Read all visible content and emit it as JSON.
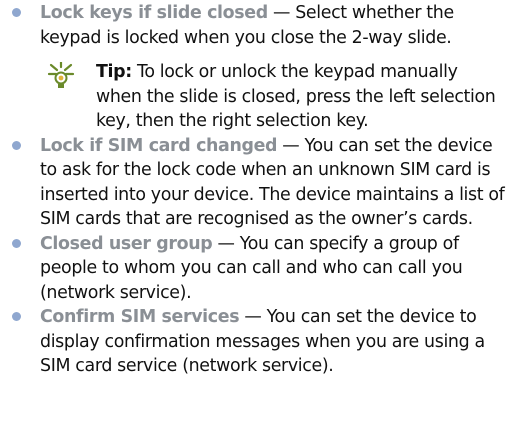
{
  "accent_colors": {
    "bullet": "#8fa7cf",
    "term": "#8a8f95",
    "tip_icon": "#6a8a2a"
  },
  "items": [
    {
      "term": "Lock keys if slide closed",
      "description": " — Select whether the keypad is locked when you close the 2-way slide."
    },
    {
      "term": "Lock if SIM card changed",
      "description": " — You can set the device to ask for the lock code when an unknown SIM card is inserted into your device. The device maintains a list of SIM cards that are recognised as the owner’s cards."
    },
    {
      "term": "Closed user group",
      "description": " — You can specify a group of people to whom you can call and who can call you (network service)."
    },
    {
      "term": "Confirm SIM services",
      "description": " — You can set the device to display confirmation messages when you are using a SIM card service (network service)."
    }
  ],
  "tip": {
    "icon": "lightbulb-icon",
    "label": "Tip:",
    "text": " To lock or unlock the keypad manually when the slide is closed, press the left selection key, then the right selection key."
  }
}
